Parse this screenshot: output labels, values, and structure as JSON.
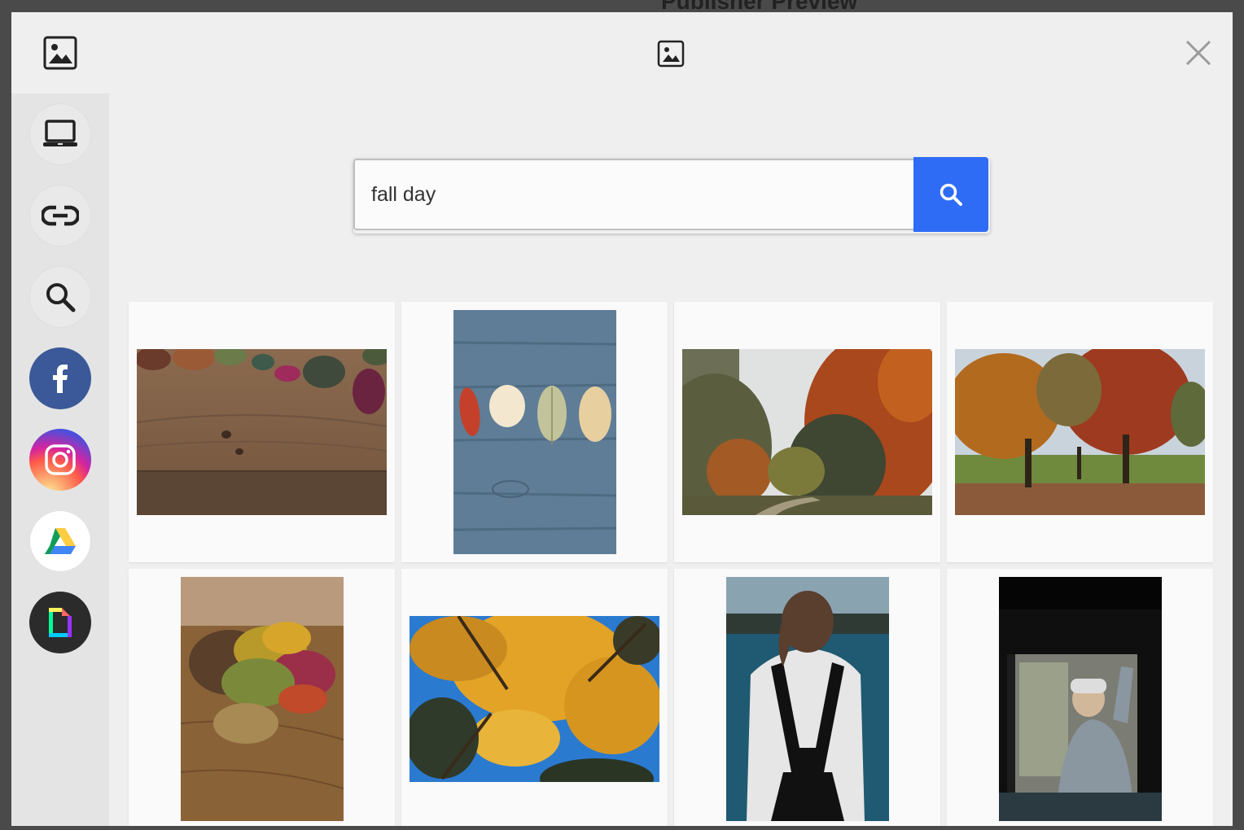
{
  "backdrop": {
    "title": "Publisher Preview"
  },
  "header": {
    "logo_icon": "image-icon",
    "center_icon": "image-icon",
    "close_icon": "close-icon"
  },
  "sidebar": {
    "items": [
      {
        "name": "computer",
        "icon": "laptop-icon"
      },
      {
        "name": "link",
        "icon": "link-icon"
      },
      {
        "name": "search",
        "icon": "search-icon"
      },
      {
        "name": "facebook",
        "icon": "facebook-icon",
        "color": "#3b5998"
      },
      {
        "name": "instagram",
        "icon": "instagram-icon"
      },
      {
        "name": "google-drive",
        "icon": "google-drive-icon"
      },
      {
        "name": "giphy",
        "icon": "giphy-icon",
        "color": "#2b2b2b"
      }
    ]
  },
  "search": {
    "value": "fall day",
    "button_icon": "search-icon",
    "button_color": "#2f6cf5"
  },
  "results": [
    {
      "subject": "autumn leaves on wooden table",
      "orientation": "landscape"
    },
    {
      "subject": "four autumn leaves on blue wood",
      "orientation": "portrait"
    },
    {
      "subject": "autumn forest path",
      "orientation": "landscape"
    },
    {
      "subject": "autumn trees in park",
      "orientation": "landscape"
    },
    {
      "subject": "pile of fallen leaves on wood",
      "orientation": "portrait"
    },
    {
      "subject": "yellow tree canopy against blue sky",
      "orientation": "landscape"
    },
    {
      "subject": "woman with backpack by lake",
      "orientation": "portrait"
    },
    {
      "subject": "man in jeep window",
      "orientation": "portrait"
    }
  ]
}
